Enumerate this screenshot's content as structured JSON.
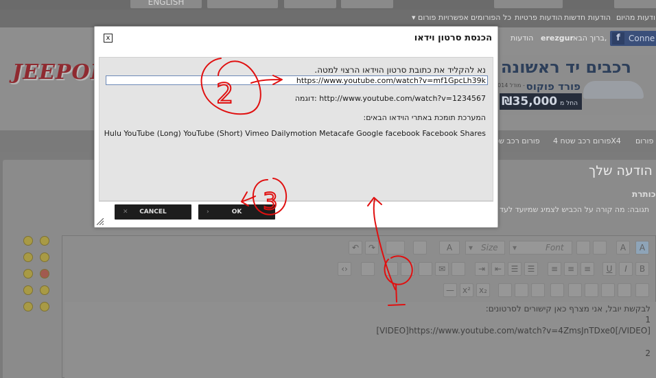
{
  "topnav": {
    "tabs": [
      "ENGLISH",
      "",
      "",
      "",
      ""
    ]
  },
  "subnav": {
    "items": [
      "הודעות מהיום",
      "הודעות חדשות",
      "הודעות פרטיות",
      "כל הפורומים",
      "אפשרויות פורום"
    ]
  },
  "header": {
    "logo": "JEEPOLO",
    "facebook_label": "Conne",
    "greeting": "ברוך הבא,",
    "username": "erezgur",
    "messages": "הודעות"
  },
  "ad": {
    "headline": "רכבים יד ראשונה",
    "sub": "פורד פוקוס",
    "model": "מודל 2014 -",
    "price": "35,000",
    "price_prefix": "החל מ",
    "price_symbol": "₪"
  },
  "breadcrumb": [
    "פורום",
    "פורום רכב שטח 4X4",
    "פורום רכב שט"
  ],
  "panel": {
    "title": "הודעה שלך",
    "subject_label": "כותרת:",
    "reply_label": "תגובה: מה קורה על הכביש לצמיג שמיועד לעד"
  },
  "toolbar": {
    "font_placeholder": "Font",
    "size_placeholder": "Size"
  },
  "editor": {
    "lines": [
      "לבקשת יובל, אני מצרף כאן קישורים לסרטונים:",
      "1",
      "[VIDEO]https://www.youtube.com/watch?v=4ZmsJnTDxe0[/VIDEO]",
      "2"
    ]
  },
  "dialog": {
    "title": "הכנסת סרטון וידאו",
    "close_label": "x",
    "instruction": "נא להקליד את כתובת סרטון הוידאו הרצוי למטה.",
    "url_value": "https://www.youtube.com/watch?v=mf1GpcLh39k",
    "example": "דוגמה:  http://www.youtube.com/watch?v=1234567",
    "supported_label": "המערכת תומכת באתרי הוידאו הבאים:",
    "sites": "Hulu YouTube (Long) YouTube (Short) Vimeo Dailymotion Metacafe Google facebook Facebook Shares",
    "cancel_label": "CANCEL",
    "ok_label": "OK"
  },
  "annotations": {
    "label_2": "2",
    "label_3": "3"
  },
  "colors": {
    "annotation": "#e01010",
    "dialog_body": "#e4e4e4",
    "button": "#1d1d1d"
  }
}
